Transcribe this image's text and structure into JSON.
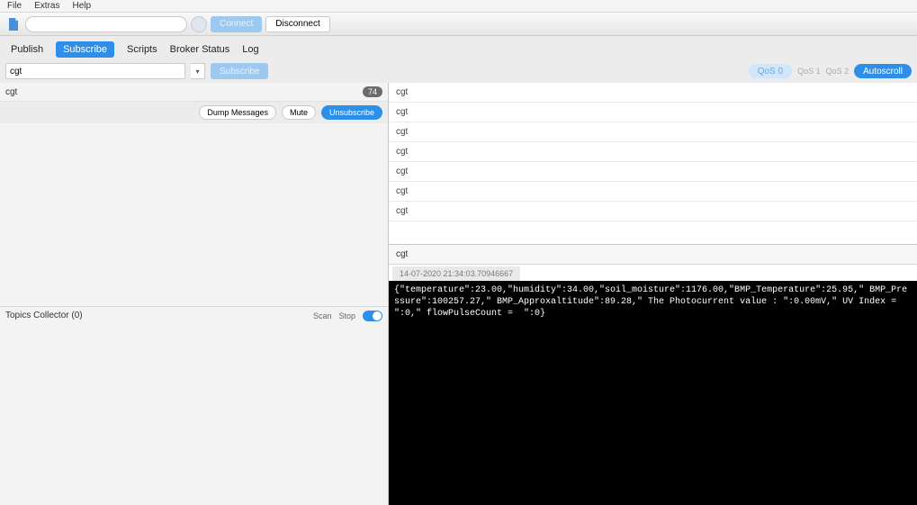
{
  "menu": {
    "file": "File",
    "extras": "Extras",
    "help": "Help"
  },
  "toolbar": {
    "address": "",
    "connect": "Connect",
    "disconnect": "Disconnect"
  },
  "tabs": {
    "publish": "Publish",
    "subscribe": "Subscribe",
    "scripts": "Scripts",
    "broker": "Broker Status",
    "log": "Log",
    "active": "subscribe"
  },
  "subscribe": {
    "topic_value": "cgt",
    "subscribe_btn": "Subscribe",
    "autoscroll": "Autoscroll",
    "qos0": "QoS 0",
    "qos1": "QoS 1",
    "qos2": "QoS 2"
  },
  "left": {
    "topic": "cgt",
    "count": "74",
    "dump": "Dump Messages",
    "mute": "Mute",
    "unsub": "Unsubscribe",
    "collector_label": "Topics Collector (0)",
    "scan": "Scan",
    "stop": "Stop"
  },
  "messages": {
    "rows": [
      "cgt",
      "cgt",
      "cgt",
      "cgt",
      "cgt",
      "cgt",
      "cgt"
    ],
    "selected_topic": "cgt",
    "timestamp": "14-07-2020 21:34:03.70946667",
    "payload": "{\"temperature\":23.00,\"humidity\":34.00,\"soil_moisture\":1176.00,\"BMP_Temperature\":25.95,\" BMP_Pressure\":100257.27,\" BMP_Approxaltitude\":89.28,\" The Photocurrent value : \":0.00mV,\" UV Index =  \":0,\" flowPulseCount =  \":0}"
  }
}
